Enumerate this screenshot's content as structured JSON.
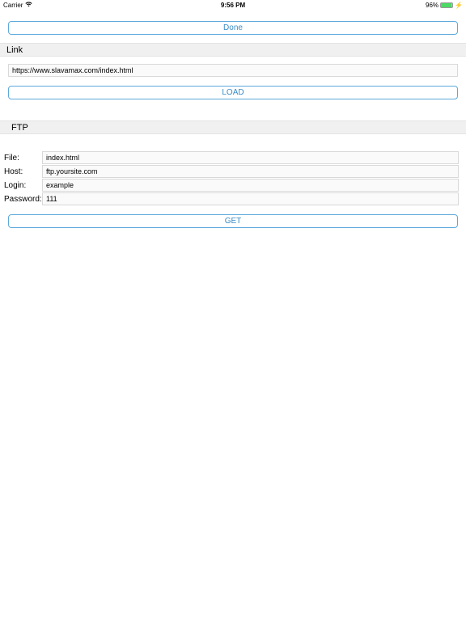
{
  "status_bar": {
    "carrier": "Carrier",
    "time": "9:56 PM",
    "battery_pct": "96%"
  },
  "buttons": {
    "done": "Done",
    "load": "LOAD",
    "get": "GET"
  },
  "sections": {
    "link": "Link",
    "ftp": "FTP"
  },
  "link": {
    "url": "https://www.slavamax.com/index.html"
  },
  "ftp": {
    "file_label": "File:",
    "file_value": "index.html",
    "host_label": "Host:",
    "host_value": "ftp.yoursite.com",
    "login_label": "Login:",
    "login_value": "example",
    "password_label": "Password:",
    "password_value": "111"
  }
}
